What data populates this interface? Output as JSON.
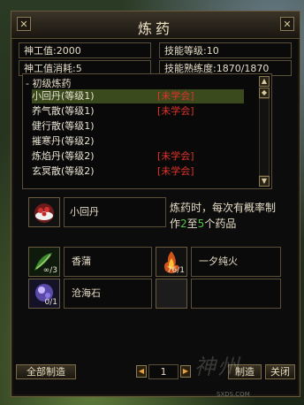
{
  "window": {
    "title": "炼药",
    "left_btn": "✕",
    "close_btn": "✕"
  },
  "stats": {
    "divine_label": "神工值:",
    "divine_value": "2000",
    "skill_level_label": "技能等级:",
    "skill_level_value": "10",
    "divine_cost_label": "神工值消耗:",
    "divine_cost_value": "5",
    "proficiency_label": "技能熟练度:",
    "proficiency_value": "1870/1870"
  },
  "recipes": {
    "category": "- 初级炼药",
    "items": [
      {
        "name": "小回丹",
        "level": "(等级1)",
        "status": "[未学会]"
      },
      {
        "name": "养气散",
        "level": "(等级1)",
        "status": "[未学会]"
      },
      {
        "name": "健行散",
        "level": "(等级1)",
        "status": ""
      },
      {
        "name": "摧寒丹",
        "level": "(等级2)",
        "status": ""
      },
      {
        "name": "炼焰丹",
        "level": "(等级2)",
        "status": "[未学会]"
      },
      {
        "name": "玄冥散",
        "level": "(等级2)",
        "status": "[未学会]"
      }
    ]
  },
  "product": {
    "name": "小回丹",
    "desc_pre": "炼药时，每次有概率制作",
    "desc_min": "2",
    "desc_mid": "至",
    "desc_max": "5",
    "desc_post": "个药品"
  },
  "materials": [
    {
      "name": "香蒲",
      "count": "∞/3"
    },
    {
      "name": "一夕纯火",
      "count": "76/1"
    },
    {
      "name": "沧海石",
      "count": "0/1"
    }
  ],
  "footer": {
    "make_all": "全部制造",
    "quantity": "1",
    "make": "制造",
    "close": "关闭",
    "prev": "◀",
    "next": "▶"
  },
  "watermark": {
    "text": "神州",
    "url": "SXDS.COM"
  },
  "colors": {
    "unlearned": "#e0332a",
    "highlight": "#53c045",
    "selected": "#3a4a1c"
  }
}
